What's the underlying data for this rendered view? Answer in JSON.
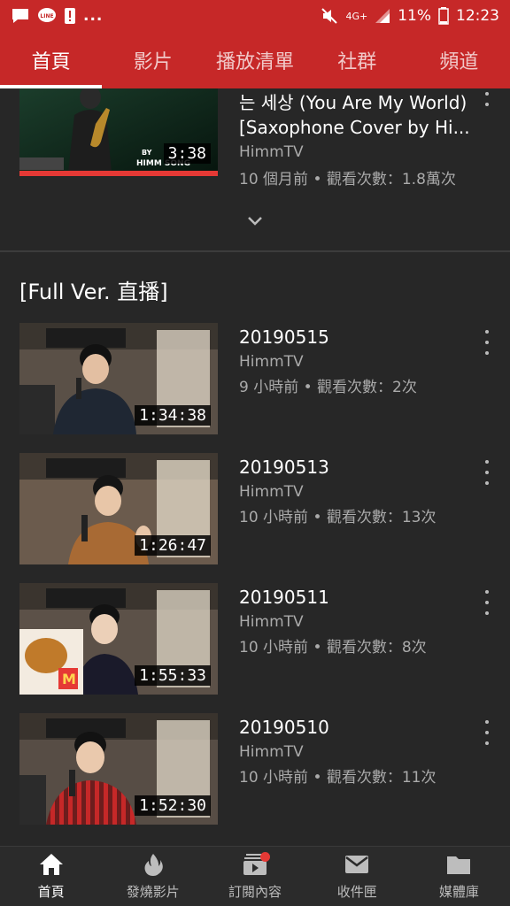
{
  "status_bar": {
    "network": "4G+",
    "battery": "11%",
    "time": "12:23",
    "overflow": "..."
  },
  "tabs": [
    {
      "label": "首頁",
      "active": true
    },
    {
      "label": "影片",
      "active": false
    },
    {
      "label": "播放清單",
      "active": false
    },
    {
      "label": "社群",
      "active": false
    },
    {
      "label": "頻道",
      "active": false
    }
  ],
  "featured": {
    "title": "는 세상 (You Are My World) [Saxophone Cover by Hi...",
    "title_line1": "는 세상 (You Are My World)",
    "title_line2": "[Saxophone Cover by Hi...",
    "channel": "HimmTV",
    "meta": "10 個月前 • 觀看次數：1.8萬次",
    "duration": "3:38",
    "thumb_caption_by": "BY",
    "thumb_caption_name": "HIMM SONG"
  },
  "section": {
    "title": "[Full Ver. 直播]"
  },
  "videos": [
    {
      "title": "20190515",
      "channel": "HimmTV",
      "meta": "9 小時前 • 觀看次數：2次",
      "duration": "1:34:38"
    },
    {
      "title": "20190513",
      "channel": "HimmTV",
      "meta": "10 小時前 • 觀看次數：13次",
      "duration": "1:26:47"
    },
    {
      "title": "20190511",
      "channel": "HimmTV",
      "meta": "10 小時前 • 觀看次數：8次",
      "duration": "1:55:33"
    },
    {
      "title": "20190510",
      "channel": "HimmTV",
      "meta": "10 小時前 • 觀看次數：11次",
      "duration": "1:52:30"
    }
  ],
  "bottom_nav": [
    {
      "label": "首頁",
      "icon": "home-icon",
      "active": true
    },
    {
      "label": "發燒影片",
      "icon": "flame-icon",
      "active": false
    },
    {
      "label": "訂閱內容",
      "icon": "subscriptions-icon",
      "active": false
    },
    {
      "label": "收件匣",
      "icon": "inbox-icon",
      "active": false
    },
    {
      "label": "媒體庫",
      "icon": "library-icon",
      "active": false
    }
  ],
  "colors": {
    "brand_red": "#c62828",
    "background": "#272727",
    "secondary_text": "#aaaaaa"
  }
}
